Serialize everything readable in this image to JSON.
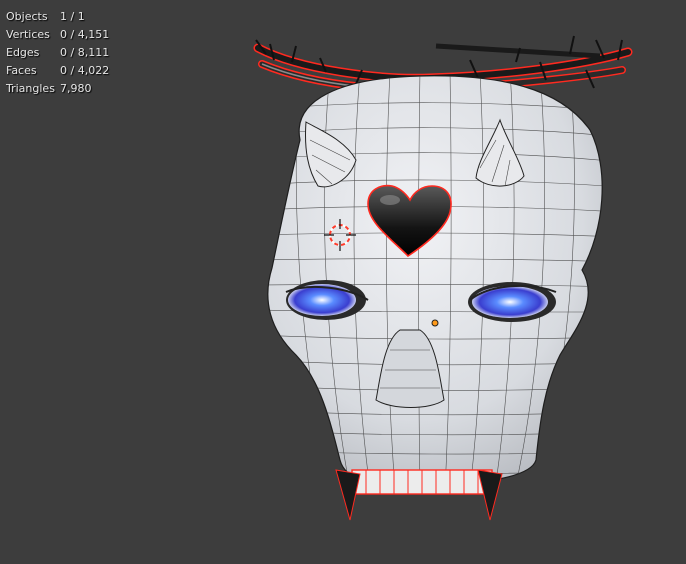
{
  "overlay": {
    "stats": [
      {
        "label": "Objects",
        "value": "1 / 1"
      },
      {
        "label": "Vertices",
        "value": "0 / 4,151"
      },
      {
        "label": "Edges",
        "value": "0 / 8,111"
      },
      {
        "label": "Faces",
        "value": "0 / 4,022"
      },
      {
        "label": "Triangles",
        "value": "7,980"
      }
    ]
  },
  "colors": {
    "background": "#3d3d3d",
    "mesh_surface": "#e4e6ea",
    "wire": "#2a2a2a",
    "selection_outline": "#ff3a2a",
    "eye_glow": "#3a6cff",
    "origin": "#ff9a1a"
  },
  "icons": [
    "3d-cursor-icon",
    "object-origin-icon"
  ]
}
